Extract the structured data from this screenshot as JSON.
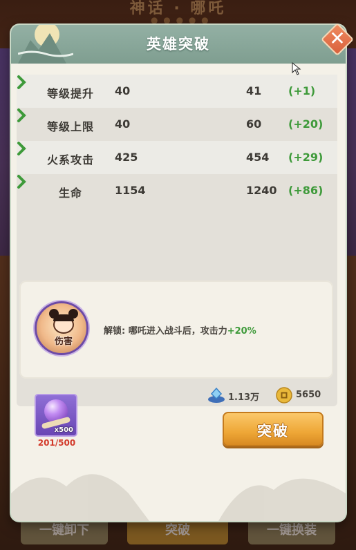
{
  "background": {
    "title": "神话 · 哪吒",
    "stars": "● ● ● ● ●",
    "buttons": [
      "一键卸下",
      "突破",
      "一键换装"
    ]
  },
  "dialog": {
    "title": "英雄突破",
    "close_label": "✕"
  },
  "stats": [
    {
      "name": "等级提升",
      "from": "40",
      "to": "41",
      "delta": "(+1)"
    },
    {
      "name": "等级上限",
      "from": "40",
      "to": "60",
      "delta": "(+20)"
    },
    {
      "name": "火系攻击",
      "from": "425",
      "to": "454",
      "delta": "(+29)"
    },
    {
      "name": "生命",
      "from": "1154",
      "to": "1240",
      "delta": "(+86)"
    }
  ],
  "unlock": {
    "skill_label": "伤害",
    "text_prefix": "解锁: 哪吒进入战斗后，攻击力",
    "text_highlight": "+20%"
  },
  "costs": {
    "gem": "1.13万",
    "coin": "5650"
  },
  "item": {
    "qty": "x500",
    "count": "201/500"
  },
  "breakthrough_button": "突破",
  "colors": {
    "header": "#87a698",
    "delta_green": "#3e9a3a",
    "button_orange": "#eea737",
    "close_orange": "#e07148",
    "count_red": "#d23a2a"
  }
}
